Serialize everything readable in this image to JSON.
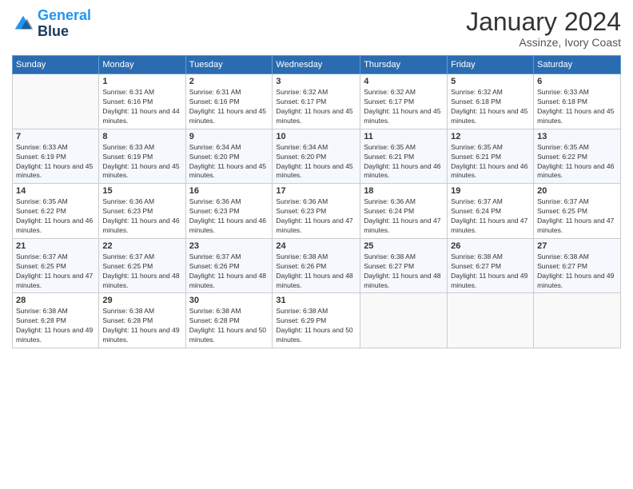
{
  "logo": {
    "line1": "General",
    "line2": "Blue"
  },
  "title": "January 2024",
  "subtitle": "Assinze, Ivory Coast",
  "headers": [
    "Sunday",
    "Monday",
    "Tuesday",
    "Wednesday",
    "Thursday",
    "Friday",
    "Saturday"
  ],
  "weeks": [
    [
      {
        "day": "",
        "sunrise": "",
        "sunset": "",
        "daylight": ""
      },
      {
        "day": "1",
        "sunrise": "Sunrise: 6:31 AM",
        "sunset": "Sunset: 6:16 PM",
        "daylight": "Daylight: 11 hours and 44 minutes."
      },
      {
        "day": "2",
        "sunrise": "Sunrise: 6:31 AM",
        "sunset": "Sunset: 6:16 PM",
        "daylight": "Daylight: 11 hours and 45 minutes."
      },
      {
        "day": "3",
        "sunrise": "Sunrise: 6:32 AM",
        "sunset": "Sunset: 6:17 PM",
        "daylight": "Daylight: 11 hours and 45 minutes."
      },
      {
        "day": "4",
        "sunrise": "Sunrise: 6:32 AM",
        "sunset": "Sunset: 6:17 PM",
        "daylight": "Daylight: 11 hours and 45 minutes."
      },
      {
        "day": "5",
        "sunrise": "Sunrise: 6:32 AM",
        "sunset": "Sunset: 6:18 PM",
        "daylight": "Daylight: 11 hours and 45 minutes."
      },
      {
        "day": "6",
        "sunrise": "Sunrise: 6:33 AM",
        "sunset": "Sunset: 6:18 PM",
        "daylight": "Daylight: 11 hours and 45 minutes."
      }
    ],
    [
      {
        "day": "7",
        "sunrise": "Sunrise: 6:33 AM",
        "sunset": "Sunset: 6:19 PM",
        "daylight": "Daylight: 11 hours and 45 minutes."
      },
      {
        "day": "8",
        "sunrise": "Sunrise: 6:33 AM",
        "sunset": "Sunset: 6:19 PM",
        "daylight": "Daylight: 11 hours and 45 minutes."
      },
      {
        "day": "9",
        "sunrise": "Sunrise: 6:34 AM",
        "sunset": "Sunset: 6:20 PM",
        "daylight": "Daylight: 11 hours and 45 minutes."
      },
      {
        "day": "10",
        "sunrise": "Sunrise: 6:34 AM",
        "sunset": "Sunset: 6:20 PM",
        "daylight": "Daylight: 11 hours and 45 minutes."
      },
      {
        "day": "11",
        "sunrise": "Sunrise: 6:35 AM",
        "sunset": "Sunset: 6:21 PM",
        "daylight": "Daylight: 11 hours and 46 minutes."
      },
      {
        "day": "12",
        "sunrise": "Sunrise: 6:35 AM",
        "sunset": "Sunset: 6:21 PM",
        "daylight": "Daylight: 11 hours and 46 minutes."
      },
      {
        "day": "13",
        "sunrise": "Sunrise: 6:35 AM",
        "sunset": "Sunset: 6:22 PM",
        "daylight": "Daylight: 11 hours and 46 minutes."
      }
    ],
    [
      {
        "day": "14",
        "sunrise": "Sunrise: 6:35 AM",
        "sunset": "Sunset: 6:22 PM",
        "daylight": "Daylight: 11 hours and 46 minutes."
      },
      {
        "day": "15",
        "sunrise": "Sunrise: 6:36 AM",
        "sunset": "Sunset: 6:23 PM",
        "daylight": "Daylight: 11 hours and 46 minutes."
      },
      {
        "day": "16",
        "sunrise": "Sunrise: 6:36 AM",
        "sunset": "Sunset: 6:23 PM",
        "daylight": "Daylight: 11 hours and 46 minutes."
      },
      {
        "day": "17",
        "sunrise": "Sunrise: 6:36 AM",
        "sunset": "Sunset: 6:23 PM",
        "daylight": "Daylight: 11 hours and 47 minutes."
      },
      {
        "day": "18",
        "sunrise": "Sunrise: 6:36 AM",
        "sunset": "Sunset: 6:24 PM",
        "daylight": "Daylight: 11 hours and 47 minutes."
      },
      {
        "day": "19",
        "sunrise": "Sunrise: 6:37 AM",
        "sunset": "Sunset: 6:24 PM",
        "daylight": "Daylight: 11 hours and 47 minutes."
      },
      {
        "day": "20",
        "sunrise": "Sunrise: 6:37 AM",
        "sunset": "Sunset: 6:25 PM",
        "daylight": "Daylight: 11 hours and 47 minutes."
      }
    ],
    [
      {
        "day": "21",
        "sunrise": "Sunrise: 6:37 AM",
        "sunset": "Sunset: 6:25 PM",
        "daylight": "Daylight: 11 hours and 47 minutes."
      },
      {
        "day": "22",
        "sunrise": "Sunrise: 6:37 AM",
        "sunset": "Sunset: 6:25 PM",
        "daylight": "Daylight: 11 hours and 48 minutes."
      },
      {
        "day": "23",
        "sunrise": "Sunrise: 6:37 AM",
        "sunset": "Sunset: 6:26 PM",
        "daylight": "Daylight: 11 hours and 48 minutes."
      },
      {
        "day": "24",
        "sunrise": "Sunrise: 6:38 AM",
        "sunset": "Sunset: 6:26 PM",
        "daylight": "Daylight: 11 hours and 48 minutes."
      },
      {
        "day": "25",
        "sunrise": "Sunrise: 6:38 AM",
        "sunset": "Sunset: 6:27 PM",
        "daylight": "Daylight: 11 hours and 48 minutes."
      },
      {
        "day": "26",
        "sunrise": "Sunrise: 6:38 AM",
        "sunset": "Sunset: 6:27 PM",
        "daylight": "Daylight: 11 hours and 49 minutes."
      },
      {
        "day": "27",
        "sunrise": "Sunrise: 6:38 AM",
        "sunset": "Sunset: 6:27 PM",
        "daylight": "Daylight: 11 hours and 49 minutes."
      }
    ],
    [
      {
        "day": "28",
        "sunrise": "Sunrise: 6:38 AM",
        "sunset": "Sunset: 6:28 PM",
        "daylight": "Daylight: 11 hours and 49 minutes."
      },
      {
        "day": "29",
        "sunrise": "Sunrise: 6:38 AM",
        "sunset": "Sunset: 6:28 PM",
        "daylight": "Daylight: 11 hours and 49 minutes."
      },
      {
        "day": "30",
        "sunrise": "Sunrise: 6:38 AM",
        "sunset": "Sunset: 6:28 PM",
        "daylight": "Daylight: 11 hours and 50 minutes."
      },
      {
        "day": "31",
        "sunrise": "Sunrise: 6:38 AM",
        "sunset": "Sunset: 6:29 PM",
        "daylight": "Daylight: 11 hours and 50 minutes."
      },
      {
        "day": "",
        "sunrise": "",
        "sunset": "",
        "daylight": ""
      },
      {
        "day": "",
        "sunrise": "",
        "sunset": "",
        "daylight": ""
      },
      {
        "day": "",
        "sunrise": "",
        "sunset": "",
        "daylight": ""
      }
    ]
  ]
}
